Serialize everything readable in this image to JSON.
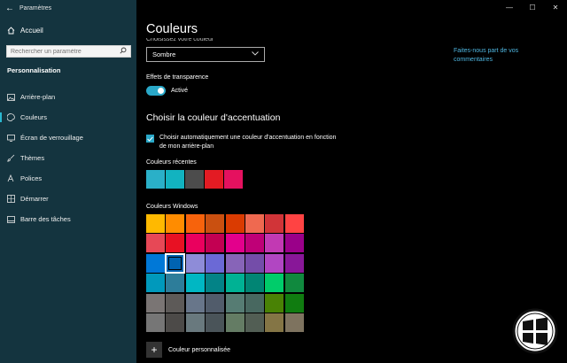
{
  "window": {
    "title": "Paramètres",
    "back_glyph": "←",
    "controls": [
      "—",
      "☐",
      "✕"
    ]
  },
  "sidebar": {
    "home_label": "Accueil",
    "search_placeholder": "Rechercher un paramètre",
    "section": "Personnalisation",
    "items": [
      {
        "label": "Arrière-plan",
        "icon": "picture-icon"
      },
      {
        "label": "Couleurs",
        "icon": "palette-icon",
        "active": true
      },
      {
        "label": "Écran de verrouillage",
        "icon": "monitor-icon"
      },
      {
        "label": "Thèmes",
        "icon": "brush-icon"
      },
      {
        "label": "Polices",
        "icon": "font-icon"
      },
      {
        "label": "Démarrer",
        "icon": "start-icon"
      },
      {
        "label": "Barre des tâches",
        "icon": "taskbar-icon"
      }
    ]
  },
  "main": {
    "title": "Couleurs",
    "clipped_label": "Choisissez votre couleur",
    "mode_value": "Sombre",
    "feedback_link": "Faites-nous part de vos commentaires",
    "transparency_label": "Effets de transparence",
    "transparency_state": "Activé",
    "accent_heading": "Choisir la couleur d'accentuation",
    "auto_accent_text": "Choisir automatiquement une couleur d'accentuation en fonction de mon arrière-plan",
    "recent_label": "Couleurs récentes",
    "recent_colors": [
      "#2ab0c8",
      "#12b3c0",
      "#4c4c4c",
      "#e31b23",
      "#e5115f"
    ],
    "windows_label": "Couleurs Windows",
    "windows_colors": [
      "#ffb900",
      "#ff8c00",
      "#f7630c",
      "#ca5010",
      "#da3b01",
      "#ef6950",
      "#d13438",
      "#ff4343",
      "#e74856",
      "#e81123",
      "#ea005e",
      "#c30052",
      "#e3008c",
      "#bf0077",
      "#c239b3",
      "#9a0089",
      "#0078d7",
      "#0063b1",
      "#8e8cd8",
      "#6b69d6",
      "#8764b8",
      "#744da9",
      "#b146c2",
      "#881798",
      "#0099bc",
      "#2d7d9a",
      "#00b7c3",
      "#038387",
      "#00b294",
      "#018574",
      "#00cc6a",
      "#10893e",
      "#7a7574",
      "#5d5a58",
      "#68768a",
      "#515c6b",
      "#567c73",
      "#486860",
      "#498205",
      "#107c10",
      "#767676",
      "#4c4a48",
      "#69797e",
      "#4a5459",
      "#647c64",
      "#525e54",
      "#847545",
      "#7e735f"
    ],
    "selected_index": 17,
    "custom_label": "Couleur personnalisée"
  }
}
